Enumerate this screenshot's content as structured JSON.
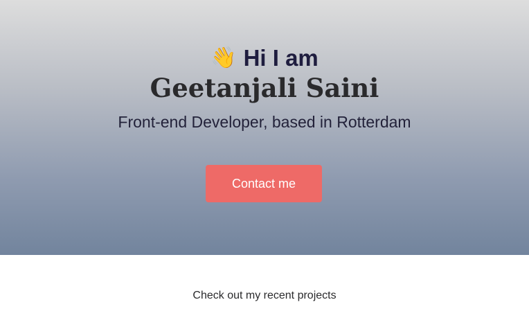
{
  "hero": {
    "wave_emoji": "👋",
    "greeting": "Hi I am",
    "name": "Geetanjali Saini",
    "subtitle": "Front-end Developer, based in Rotterdam",
    "contact_button": "Contact me"
  },
  "projects": {
    "intro": "Check out my recent projects"
  },
  "colors": {
    "accent": "#ee6a67",
    "heading": "#1f1d3f",
    "gradient_top": "#dddddd",
    "gradient_bottom": "#72849d"
  }
}
